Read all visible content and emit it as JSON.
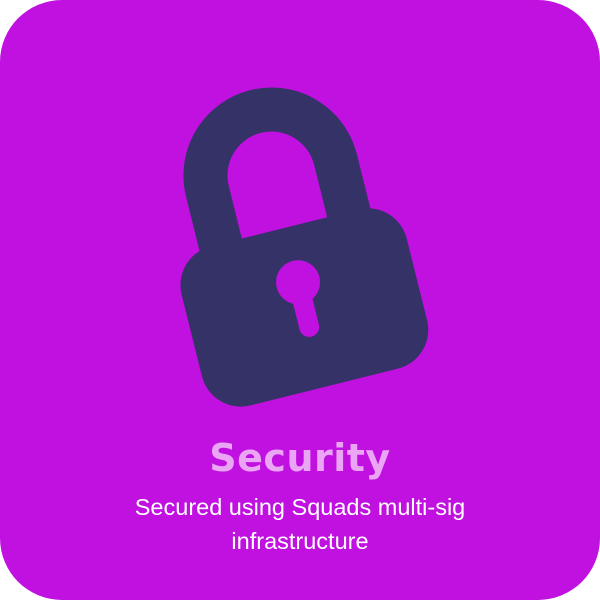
{
  "card": {
    "title": "Security",
    "description": "Secured using Squads multi-sig infrastructure",
    "icon": "lock-icon"
  },
  "colors": {
    "background": "#c011e0",
    "lock": "#343266",
    "title": "#eaa5f5",
    "description": "#ffffff"
  }
}
